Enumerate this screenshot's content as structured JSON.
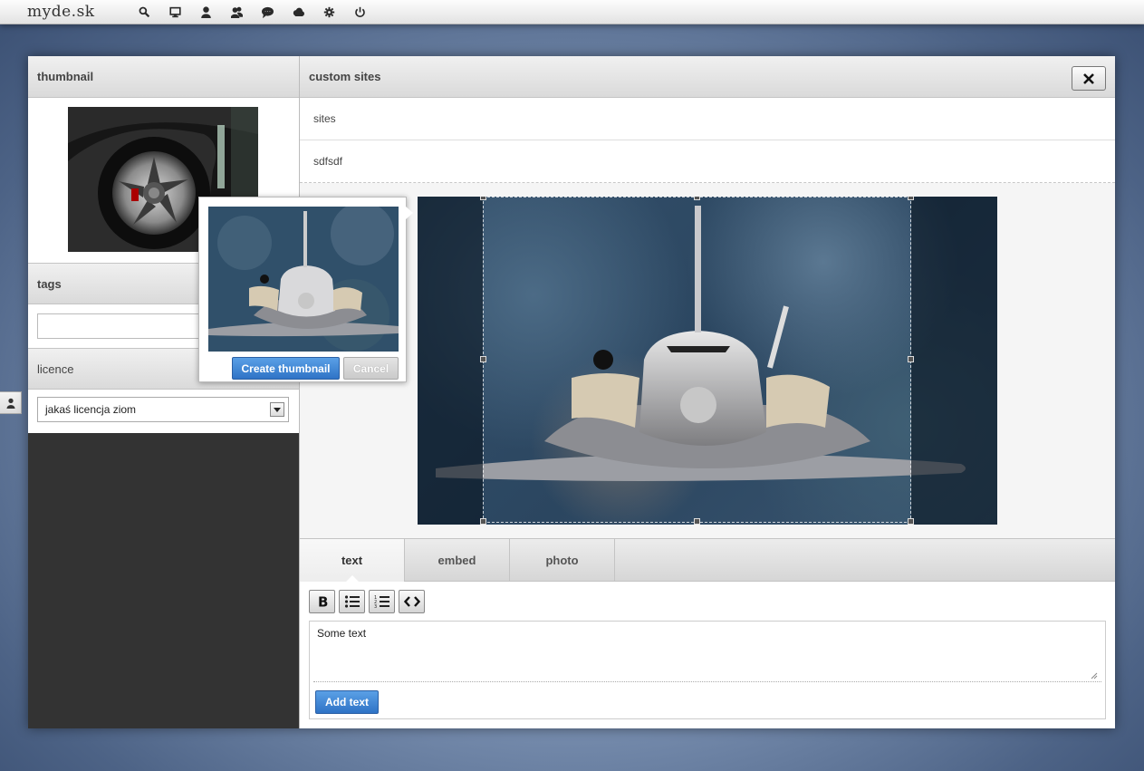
{
  "topbar": {
    "logo": "myde.sk",
    "icons": [
      "search-icon",
      "monitor-icon",
      "user-icon",
      "users-icon",
      "chat-icon",
      "cloud-icon",
      "gear-icon",
      "power-icon"
    ]
  },
  "left": {
    "thumbnail_title": "thumbnail",
    "tags_title": "tags",
    "tags_value": "",
    "licence_title": "licence",
    "licence_selected": "jakaś licencja ziom"
  },
  "right": {
    "title": "custom sites",
    "rows": [
      "sites",
      "sdfsdf"
    ],
    "tabs": [
      {
        "label": "text",
        "active": true
      },
      {
        "label": "embed",
        "active": false
      },
      {
        "label": "photo",
        "active": false
      }
    ],
    "editor": {
      "text": "Some text",
      "add_label": "Add text",
      "toolbar": [
        "bold-icon",
        "bullet-list-icon",
        "numbered-list-icon",
        "code-icon"
      ]
    }
  },
  "popover": {
    "create_label": "Create thumbnail",
    "cancel_label": "Cancel"
  },
  "colors": {
    "accent": "#2f73c6",
    "panel_dark": "#333333"
  }
}
